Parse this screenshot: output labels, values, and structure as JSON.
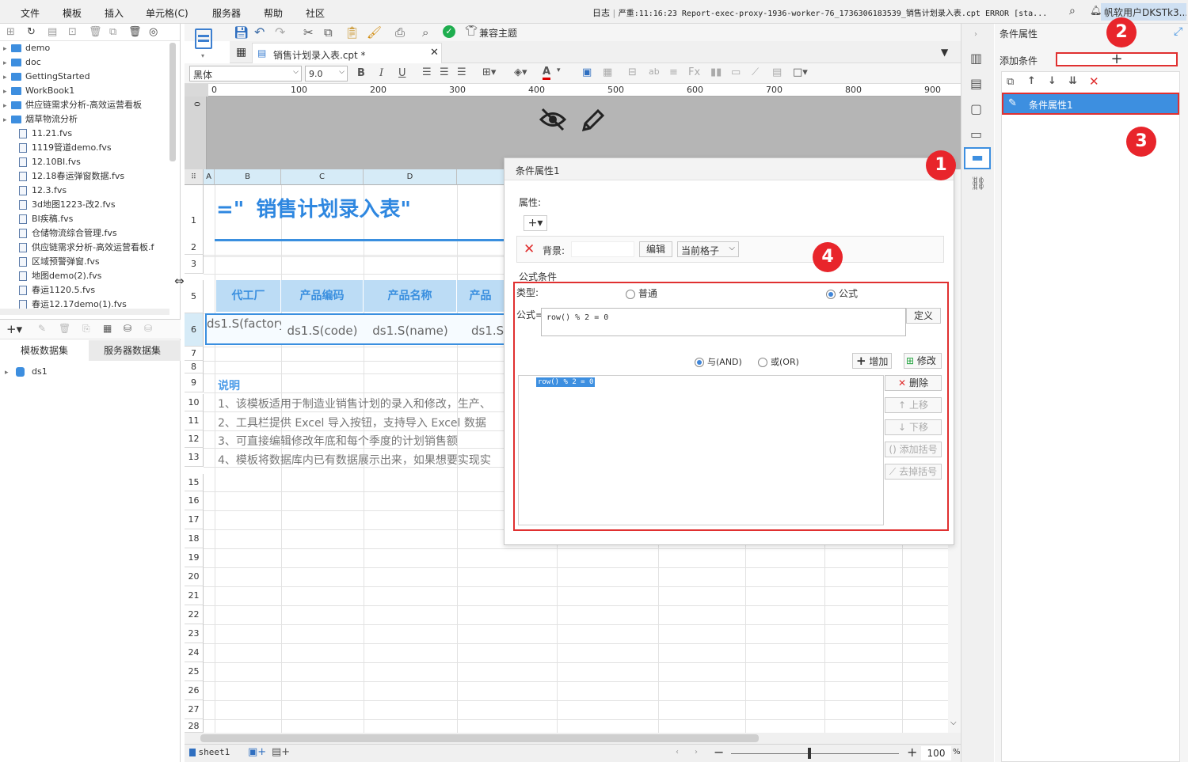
{
  "menubar": {
    "items": [
      "文件",
      "模板",
      "插入",
      "单元格(C)",
      "服务器",
      "帮助",
      "社区"
    ],
    "log_label": "日志",
    "status_message": "严重:11:16:23 Report-exec-proxy-1936-worker-76_1736306183539_销售计划录入表.cpt ERROR [sta...",
    "user": "帆软用户DKSTk3..."
  },
  "left_panel": {
    "tree": [
      {
        "type": "folder",
        "name": "demo"
      },
      {
        "type": "folder",
        "name": "doc"
      },
      {
        "type": "folder",
        "name": "GettingStarted"
      },
      {
        "type": "folder",
        "name": "WorkBook1"
      },
      {
        "type": "folder",
        "name": "供应链需求分析-高效运营看板"
      },
      {
        "type": "folder",
        "name": "烟草物流分析"
      },
      {
        "type": "file",
        "name": "11.21.fvs"
      },
      {
        "type": "file",
        "name": "1119管道demo.fvs"
      },
      {
        "type": "file",
        "name": "12.10BI.fvs"
      },
      {
        "type": "file",
        "name": "12.18春运弹窗数据.fvs"
      },
      {
        "type": "file",
        "name": "12.3.fvs"
      },
      {
        "type": "file",
        "name": "3d地图1223-改2.fvs"
      },
      {
        "type": "file",
        "name": "BI疾稿.fvs"
      },
      {
        "type": "file",
        "name": "仓储物流综合管理.fvs"
      },
      {
        "type": "file",
        "name": "供应链需求分析-高效运营看板.f"
      },
      {
        "type": "file",
        "name": "区域预警弹窗.fvs"
      },
      {
        "type": "file",
        "name": "地图demo(2).fvs"
      },
      {
        "type": "file",
        "name": "春运1120.5.fvs"
      },
      {
        "type": "file",
        "name": "春运12.17demo(1).fvs"
      }
    ],
    "dataset_tabs": [
      "模板数据集",
      "服务器数据集"
    ],
    "datasets": [
      "ds1"
    ]
  },
  "toolbar": {
    "compat_theme": "兼容主题"
  },
  "document_tab": {
    "name": "销售计划录入表.cpt *"
  },
  "format_bar": {
    "font": "黑体",
    "size": "9.0",
    "bold": "B",
    "italic": "I",
    "underline": "U",
    "color_letter": "A"
  },
  "ruler": {
    "ticks": [
      "0",
      "100",
      "200",
      "300",
      "400",
      "500",
      "600",
      "700",
      "800",
      "900"
    ],
    "v_zero": "0"
  },
  "sheet": {
    "columns": [
      "A",
      "B",
      "C",
      "D"
    ],
    "rows": [
      "1",
      "2",
      "3",
      "5",
      "6",
      "7",
      "8",
      "9",
      "10",
      "11",
      "12",
      "13",
      "15",
      "16",
      "17",
      "18",
      "19",
      "20",
      "21",
      "22",
      "23",
      "24",
      "25",
      "26",
      "27",
      "28"
    ],
    "title_prefix": "=\"",
    "title": "销售计划录入表\"",
    "headers": [
      "代工厂",
      "产品编码",
      "产品名称",
      "产品"
    ],
    "data": [
      "ds1.S(factory)",
      "ds1.S(code)",
      "ds1.S(name)",
      "ds1.S"
    ],
    "note_title": "说明",
    "notes": [
      "1、该模板适用于制造业销售计划的录入和修改，生产、",
      "2、工具栏提供 Excel 导入按钮，支持导入 Excel 数据",
      "3、可直接编辑修改年底和每个季度的计划销售额",
      "4、模板将数据库内已有数据展示出来，如果想要实现实"
    ]
  },
  "bottom_bar": {
    "sheet_name": "sheet1",
    "zoom_value": "100",
    "zoom_unit": "%",
    "zoom_minus": "−",
    "zoom_plus": "+"
  },
  "dialog": {
    "title": "条件属性1",
    "attr_label": "属性:",
    "background_label": "背景:",
    "edit_button": "编辑",
    "scope_select": "当前格子",
    "formula_section": "公式条件",
    "type_label": "类型:",
    "type_normal": "普通",
    "type_formula": "公式",
    "formula_label": "公式=",
    "formula_value": "row() % 2 = 0",
    "define_button": "定义",
    "and_label": "与(AND)",
    "or_label": "或(OR)",
    "add_button": "增加",
    "modify_button": "修改",
    "condition_item": "row() % 2 = 0",
    "delete_button": "删除",
    "move_up": "上移",
    "move_down": "下移",
    "add_bracket": "添加括号",
    "remove_bracket": "去掉括号"
  },
  "right_panel": {
    "title": "条件属性",
    "add_condition_label": "添加条件",
    "add_symbol": "+",
    "items": [
      "条件属性1"
    ]
  },
  "annotations": [
    "1",
    "2",
    "3",
    "4"
  ],
  "colors": {
    "accent": "#3f85d8",
    "selection": "#3d8fe0",
    "annotation_red": "#e8252b",
    "header_fill": "#bcdcf5",
    "title_blue": "#2e87e0"
  }
}
